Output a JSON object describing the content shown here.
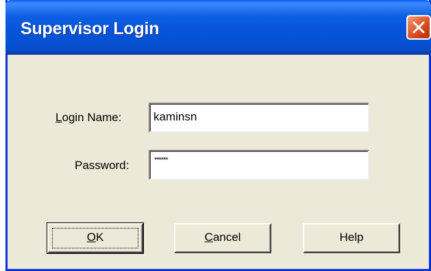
{
  "window": {
    "title": "Supervisor Login"
  },
  "form": {
    "login_name_label": {
      "accel": "L",
      "rest": "ogin Name:"
    },
    "login_name_value": "kaminsn",
    "password_label": "Password:",
    "password_value": "******"
  },
  "buttons": {
    "ok": {
      "accel": "O",
      "rest": "K"
    },
    "cancel": {
      "accel": "C",
      "rest": "ancel"
    },
    "help": "Help"
  },
  "colors": {
    "titlebar": "#0551d4",
    "dialog_bg": "#ece9d8",
    "close_button": "#cc3c12"
  },
  "icons": {
    "close": "close-icon"
  }
}
